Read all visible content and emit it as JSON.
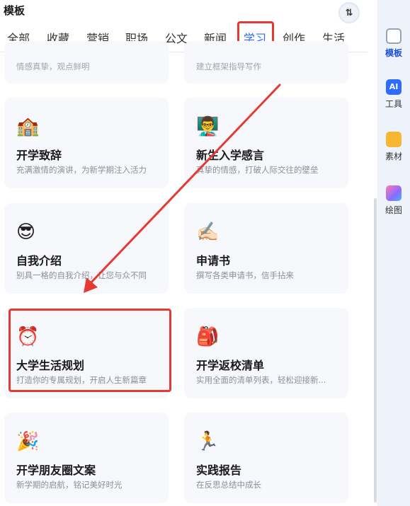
{
  "panel": {
    "title": "模板"
  },
  "sort_button": {
    "glyph": "⇅"
  },
  "tabs": [
    {
      "label": "全部"
    },
    {
      "label": "收藏"
    },
    {
      "label": "营销"
    },
    {
      "label": "职场"
    },
    {
      "label": "公文"
    },
    {
      "label": "新闻"
    },
    {
      "label": "学习",
      "active": true
    },
    {
      "label": "创作"
    },
    {
      "label": "生活"
    }
  ],
  "partial_cards": [
    {
      "desc": "情感真挚，观点鲜明"
    },
    {
      "desc": "建立框架指导写作"
    }
  ],
  "cards": [
    {
      "emoji": "🏫",
      "title": "开学致辞",
      "desc": "充满激情的演讲，为新学期注入活力"
    },
    {
      "emoji": "👨‍🏫",
      "title": "新生入学感言",
      "desc": "真挚的情感，打破人际交往的壁垒"
    },
    {
      "emoji": "😎",
      "title": "自我介绍",
      "desc": "别具一格的自我介绍，让您与众不同"
    },
    {
      "emoji": "✍🏻",
      "title": "申请书",
      "desc": "撰写各类申请书，信手拈来"
    },
    {
      "emoji": "⏰",
      "title": "大学生活规划",
      "desc": "打造你的专属规划，开启人生新篇章"
    },
    {
      "emoji": "🎒",
      "title": "开学返校清单",
      "desc": "实用全面的清单列表，轻松迎接新..."
    },
    {
      "emoji": "🎉",
      "title": "开学朋友圈文案",
      "desc": "新学期的启航，铭记美好时光"
    },
    {
      "emoji": "🏃",
      "title": "实践报告",
      "desc": "在反思总结中成长"
    }
  ],
  "sidebar": [
    {
      "label": "模板",
      "icon": "template-icon",
      "active": true
    },
    {
      "label": "工具",
      "icon": "ai-tools-icon",
      "badge": "AI"
    },
    {
      "label": "素材",
      "icon": "folder-icon"
    },
    {
      "label": "绘图",
      "icon": "paint-icon"
    }
  ],
  "colors": {
    "accent": "#2f6bff",
    "highlight": "#e53935",
    "sidebar_bg": "#eef2fb",
    "card_bg": "#f7f8fc"
  }
}
